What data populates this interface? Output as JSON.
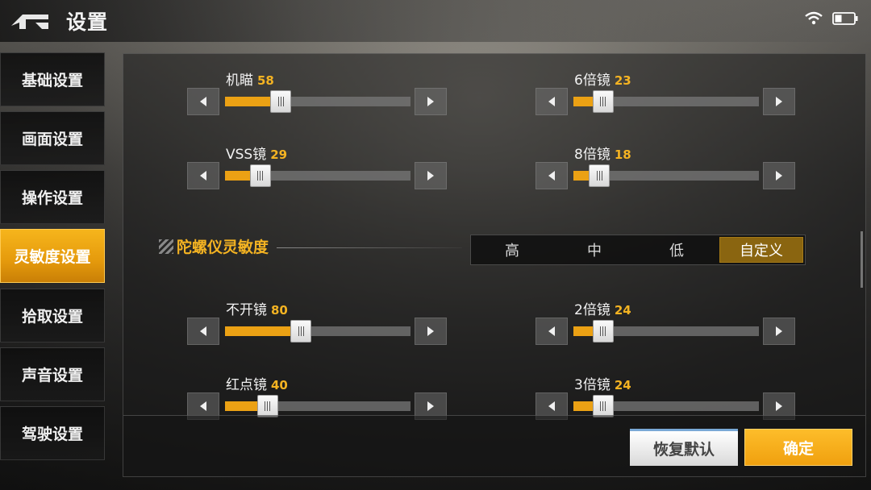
{
  "header": {
    "title": "设置"
  },
  "sidebar": {
    "items": [
      {
        "label": "基础设置",
        "active": false
      },
      {
        "label": "画面设置",
        "active": false
      },
      {
        "label": "操作设置",
        "active": false
      },
      {
        "label": "灵敏度设置",
        "active": true
      },
      {
        "label": "拾取设置",
        "active": false
      },
      {
        "label": "声音设置",
        "active": false
      },
      {
        "label": "驾驶设置",
        "active": false
      }
    ]
  },
  "sliders_top": [
    {
      "label": "机瞄",
      "value": "58",
      "percent": 30
    },
    {
      "label": "6倍镜",
      "value": "23",
      "percent": 16
    },
    {
      "label": "VSS镜",
      "value": "29",
      "percent": 19
    },
    {
      "label": "8倍镜",
      "value": "18",
      "percent": 14
    }
  ],
  "gyro": {
    "title": "陀螺仪灵敏度",
    "options": [
      "高",
      "中",
      "低",
      "自定义"
    ],
    "selected": "自定义"
  },
  "sliders_gyro": [
    {
      "label": "不开镜",
      "value": "80",
      "percent": 41
    },
    {
      "label": "2倍镜",
      "value": "24",
      "percent": 16
    },
    {
      "label": "红点镜",
      "value": "40",
      "percent": 23
    },
    {
      "label": "3倍镜",
      "value": "24",
      "percent": 16
    }
  ],
  "footer": {
    "reset_label": "恢复默认",
    "confirm_label": "确定"
  },
  "colors": {
    "accent": "#f4b322",
    "active_tab": "#eba114"
  }
}
